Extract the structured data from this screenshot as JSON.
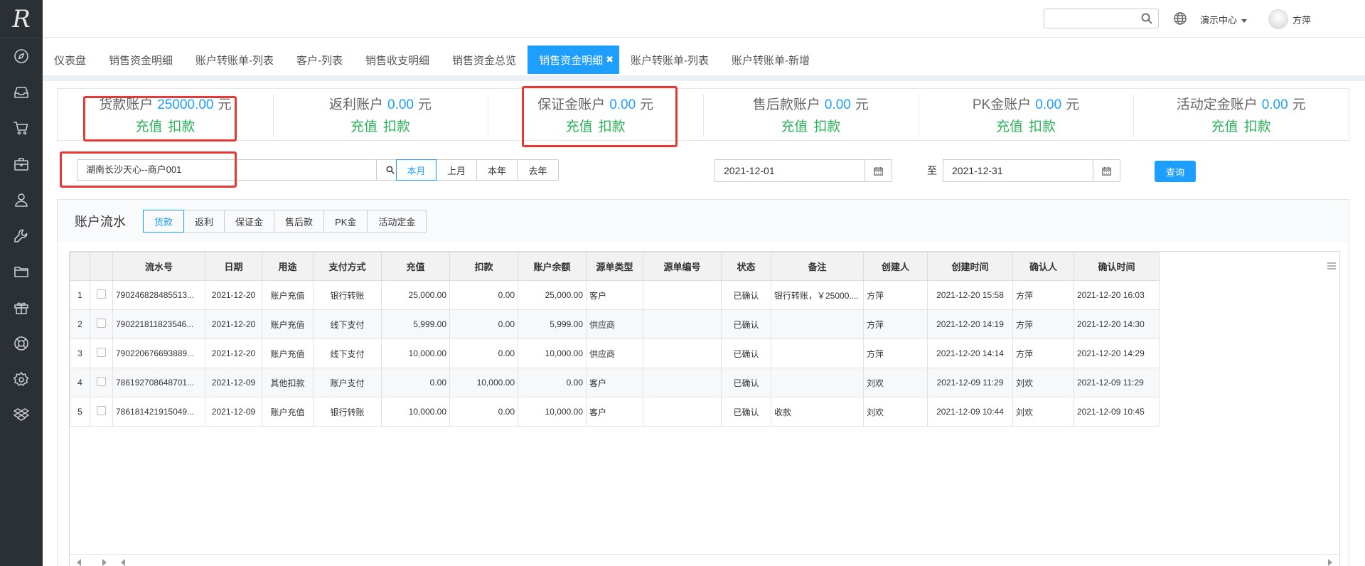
{
  "sidebar": {
    "logo": "R",
    "icons": [
      "compass-icon",
      "inbox-icon",
      "cart-icon",
      "briefcase-icon",
      "user-icon",
      "wrench-icon",
      "folder-icon",
      "gift-icon",
      "lifebuoy-icon",
      "gear-icon",
      "dropbox-icon"
    ]
  },
  "header": {
    "search_value": "",
    "center_menu": "演示中心",
    "user_name": "方萍"
  },
  "tabs": [
    {
      "label": "仪表盘",
      "active": false
    },
    {
      "label": "销售资金明细",
      "active": false
    },
    {
      "label": "账户转账单-列表",
      "active": false
    },
    {
      "label": "客户-列表",
      "active": false
    },
    {
      "label": "销售收支明细",
      "active": false
    },
    {
      "label": "销售资金总览",
      "active": false
    },
    {
      "label": "销售资金明细",
      "active": true,
      "close": "✖"
    },
    {
      "label": "账户转账单-列表",
      "active": false
    },
    {
      "label": "账户转账单-新增",
      "active": false
    }
  ],
  "accounts": [
    {
      "name": "货款账户",
      "value": "25000.00",
      "unit": "元",
      "recharge": "充值",
      "deduct": "扣款"
    },
    {
      "name": "返利账户",
      "value": "0.00",
      "unit": "元",
      "recharge": "充值",
      "deduct": "扣款"
    },
    {
      "name": "保证金账户",
      "value": "0.00",
      "unit": "元",
      "recharge": "充值",
      "deduct": "扣款"
    },
    {
      "name": "售后款账户",
      "value": "0.00",
      "unit": "元",
      "recharge": "充值",
      "deduct": "扣款"
    },
    {
      "name": "PK金账户",
      "value": "0.00",
      "unit": "元",
      "recharge": "充值",
      "deduct": "扣款"
    },
    {
      "name": "活动定金账户",
      "value": "0.00",
      "unit": "元",
      "recharge": "充值",
      "deduct": "扣款"
    }
  ],
  "filters": {
    "customer": "湖南长沙天心--商户001",
    "periods": [
      "本月",
      "上月",
      "本年",
      "去年"
    ],
    "active_period": "本月",
    "date_from": "2021-12-01",
    "date_to_label": "至",
    "date_to": "2021-12-31",
    "query_label": "查询"
  },
  "ledger": {
    "title": "账户流水",
    "type_tabs": [
      "货款",
      "返利",
      "保证金",
      "售后款",
      "PK金",
      "活动定金"
    ],
    "active_type": "货款",
    "columns": [
      "",
      "",
      "流水号",
      "日期",
      "用途",
      "支付方式",
      "充值",
      "扣款",
      "账户余额",
      "源单类型",
      "源单编号",
      "状态",
      "备注",
      "创建人",
      "创建时间",
      "确认人",
      "确认时间"
    ],
    "rows": [
      [
        "1",
        "",
        "790246828485513...",
        "2021-12-20",
        "账户充值",
        "银行转账",
        "25,000.00",
        "0.00",
        "25,000.00",
        "客户",
        "",
        "已确认",
        "银行转账，￥25000....",
        "方萍",
        "2021-12-20 15:58",
        "方萍",
        "2021-12-20 16:03"
      ],
      [
        "2",
        "",
        "790221811823546...",
        "2021-12-20",
        "账户充值",
        "线下支付",
        "5,999.00",
        "0.00",
        "5,999.00",
        "供应商",
        "",
        "已确认",
        "",
        "方萍",
        "2021-12-20 14:19",
        "方萍",
        "2021-12-20 14:30"
      ],
      [
        "3",
        "",
        "790220676693889...",
        "2021-12-20",
        "账户充值",
        "线下支付",
        "10,000.00",
        "0.00",
        "10,000.00",
        "供应商",
        "",
        "已确认",
        "",
        "方萍",
        "2021-12-20 14:14",
        "方萍",
        "2021-12-20 14:29"
      ],
      [
        "4",
        "",
        "786192708648701...",
        "2021-12-09",
        "其他扣款",
        "账户支付",
        "0.00",
        "10,000.00",
        "0.00",
        "客户",
        "",
        "已确认",
        "",
        "刘欢",
        "2021-12-09 11:29",
        "刘欢",
        "2021-12-09 11:29"
      ],
      [
        "5",
        "",
        "786181421915049...",
        "2021-12-09",
        "账户充值",
        "银行转账",
        "10,000.00",
        "0.00",
        "10,000.00",
        "客户",
        "",
        "已确认",
        "收款",
        "刘欢",
        "2021-12-09 10:44",
        "刘欢",
        "2021-12-09 10:45"
      ]
    ]
  }
}
